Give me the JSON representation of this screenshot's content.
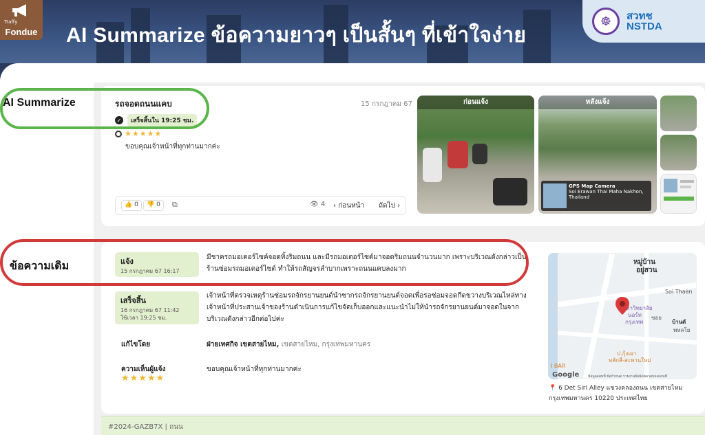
{
  "header": {
    "logo_small": "Traffy",
    "logo_text": "Fondue",
    "title": "AI Summarize ข้อความยาวๆ เป็นสั้นๆ ที่เข้าใจง่าย",
    "org_line1": "สวทช",
    "org_line2": "NSTDA"
  },
  "labels": {
    "ai_summarize": "AI Summarize",
    "original_text": "ข้อความเดิม"
  },
  "ticket": {
    "title": "รถจอดถนนแคบ",
    "date": "15 กรกฎาคม 67",
    "done_badge": "เสร็จสิ้นใน 19:25 ชม.",
    "stars": "★★★★★",
    "comment": "ขอบคุณเจ้าหน้าที่ทุกท่านมากค่ะ",
    "likes": "0",
    "dislikes": "0",
    "views": "4",
    "prev": "ก่อนหน้า",
    "next": "ถัดไป",
    "photo_before": "ก่อนแจ้ง",
    "photo_after": "หลังแจ้ง",
    "gps_title": "GPS Map Camera",
    "gps_line": "Soi Erawan Thai Maha Nakhon, Thailand"
  },
  "detail": {
    "report_label": "แจ้ง",
    "report_date": "15 กรกฎาคม 67 16:17",
    "report_text": "มีชาครถมอเตอร์ไซค์จอดทิ้งริมถนน และมีรถมอเตอร์ไซต์มาจอดริมถนนจำนวนมาก เพราะบริเวณดังกล่าวเป็นร้านซ่อมรถมอเตอร์ไซต์ ทำให้รถสัญจรลำบากเพราะถนนแคบลงมาก",
    "done_label": "เสร็จสิ้น",
    "done_date": "16 กรกฎาคม 67 11:42",
    "done_duration": "ใช้เวลา 19:25 ชม.",
    "done_text": "เจ้าหน้าที่ตรวจเหตุร้านซ่อมรถจักรยานยนต์นำซากรถจักรยานยนต์จอดเพื่อรอซ่อมจอดกีดขวางบริเวณไหล่ทางเจ้าหน้าที่ประสานเจ้าของร้านดำเนินการแก้ไขจัดเก็บออกและแนะนำไม่ให้นำรถจักรยานยนต์มาจอดในจากบริเวณดังกล่าวอีกต่อไปค่ะ",
    "fixed_by_label": "แก้ไขโดย",
    "fixed_by_bold": "ฝ่ายเทศกิจ เขตสายไหม,",
    "fixed_by_rest": " เขตสายไหม, กรุงเทพมหานคร",
    "feedback_label": "ความเห็นผู้แจ้ง",
    "feedback_stars": "★★★★★",
    "feedback_text": "ขอบคุณเจ้าหน้าที่ทุกท่านมากค่ะ"
  },
  "map": {
    "place1": "หมู่บ้าน",
    "place1b": "อยู่สวน",
    "road1": "Soi Thaen",
    "place2": "ซอย",
    "place3": "มหาวิทยาลัย",
    "place3b": "นอร์ท",
    "place3c": "กรุงเทพ",
    "place4": "ป.กุ้งเผา",
    "place4b": "หลักสี่-สะพานใหม่",
    "place5": "บ้านดั",
    "place5b": "พหลโย",
    "shop": "I BAR",
    "google": "Google",
    "attribution": "ข้อมูลแผนที่   ข้อกำหนด   รายงานข้อผิดพลาดของแผนที่",
    "address": "6 Det Siri Alley แขวงคลองถนน เขตสายไหม กรุงเทพมหานคร 10220 ประเทศไทย"
  },
  "footer": {
    "ticket_id": "#2024-GAZB7X",
    "category": "ถนน"
  },
  "colors": {
    "green_oval": "#5bb54a",
    "red_oval": "#d23a3a",
    "badge_green": "#e3f0cf",
    "star": "#f2b532"
  }
}
